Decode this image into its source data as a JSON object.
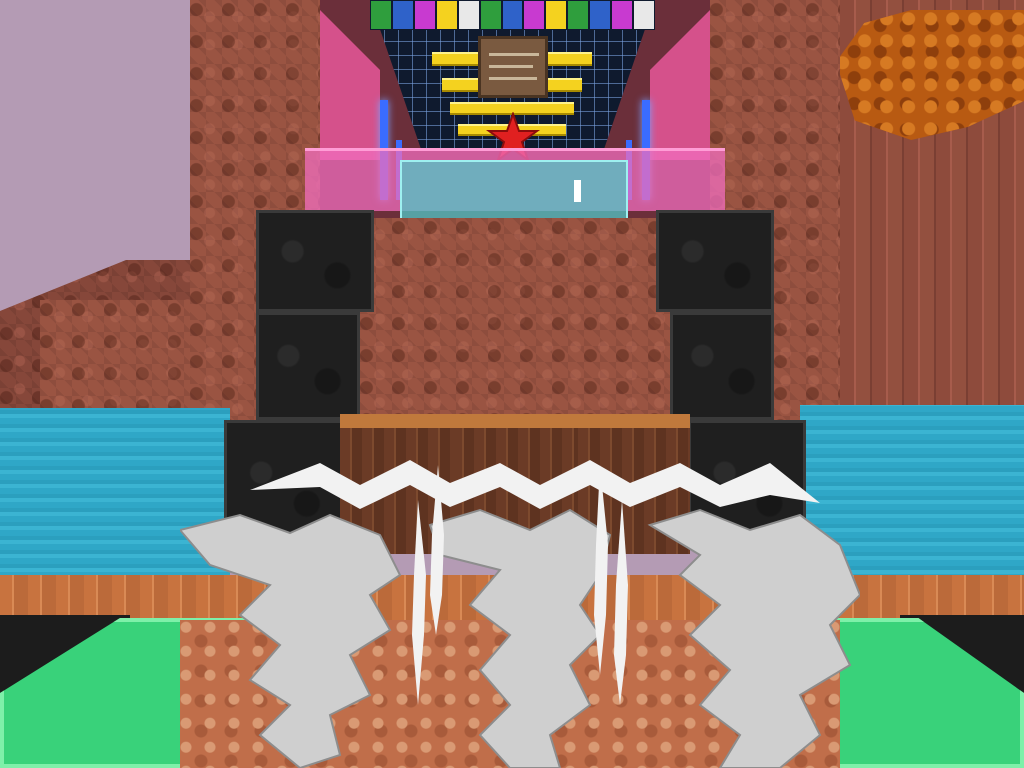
{
  "scene": {
    "view": "first-person",
    "sky_color": "#b49bb4",
    "water_color": "#2fa7c7",
    "brick_color": "#9a5442",
    "accent_pink": "#f05aa0",
    "accent_blue": "#3a6cff",
    "star_color": "#e02020",
    "ceiling_lights": [
      "#2f9e3d",
      "#2f62c9",
      "#c83ad0",
      "#f4d21f",
      "#e03a3a",
      "#e8e8e8"
    ]
  },
  "icons": {
    "star": "star-icon",
    "sign": "sign-board",
    "hand": "held-item"
  }
}
